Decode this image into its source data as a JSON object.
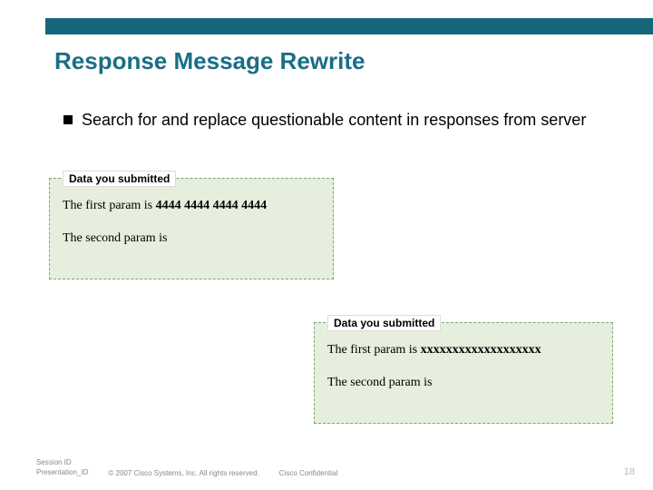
{
  "header": {
    "title": "Response Message Rewrite"
  },
  "bullet": {
    "text": "Search for and replace questionable content in responses from server"
  },
  "panel1": {
    "title": "Data you submitted",
    "line1_prefix": "The first param is ",
    "line1_value": "4444 4444 4444 4444",
    "line2": "The second param is"
  },
  "panel2": {
    "title": "Data you submitted",
    "line1_prefix": "The first param is ",
    "line1_value": "xxxxxxxxxxxxxxxxxxx",
    "line2": "The second param is"
  },
  "footer": {
    "session_label": "Session ID",
    "presentation_label": "Presentation_ID",
    "copyright": "© 2007 Cisco Systems, Inc. All rights reserved.",
    "confidential": "Cisco Confidential",
    "page": "18"
  }
}
